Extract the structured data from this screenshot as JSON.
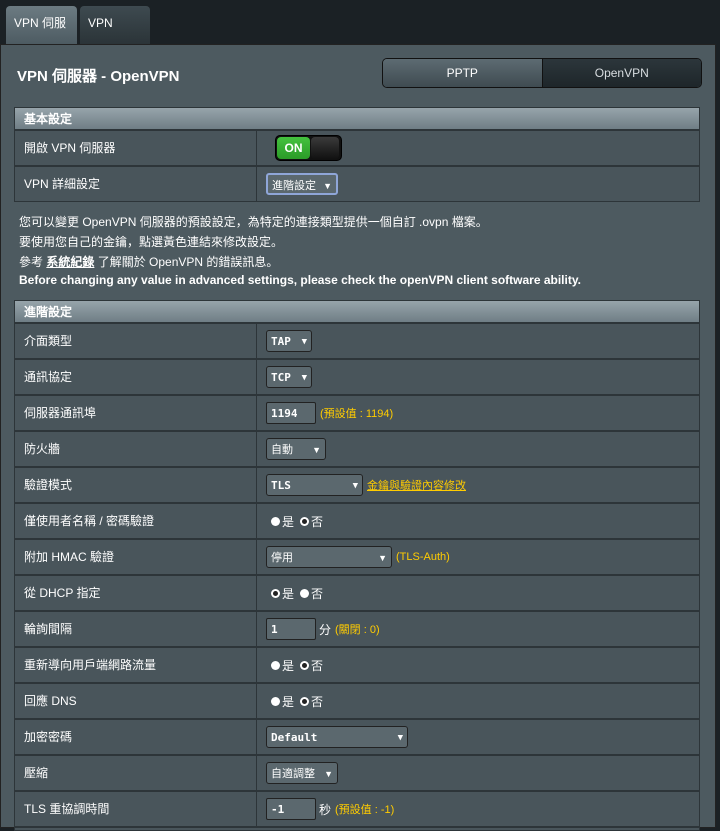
{
  "tabs": [
    {
      "label": "VPN 伺服器"
    },
    {
      "label": "VPN Client"
    }
  ],
  "page_title": "VPN 伺服器 - OpenVPN",
  "segments": [
    "PPTP",
    "OpenVPN"
  ],
  "basic": {
    "header": "基本設定",
    "enable_label": "開啟 VPN 伺服器",
    "toggle_text": "ON",
    "detail_label": "VPN 詳細設定",
    "detail_value": "進階設定"
  },
  "desc": {
    "line1": "您可以變更 OpenVPN 伺服器的預設設定，為特定的連接類型提供一個自訂 .ovpn 檔案。",
    "line2": "要使用您自己的金鑰，點選黃色連結來修改設定。",
    "line3_pre": "參考",
    "line3_link": "系統紀錄",
    "line3_post": "了解關於 OpenVPN 的錯誤訊息。",
    "line4": "Before changing any value in advanced settings, please check the openVPN client software ability."
  },
  "advanced": {
    "header": "進階設定",
    "rows": {
      "iface_label": "介面類型",
      "iface_value": "TAP",
      "proto_label": "通訊協定",
      "proto_value": "TCP",
      "port_label": "伺服器通訊埠",
      "port_value": "1194",
      "port_note": "(預設值 : 1194)",
      "fw_label": "防火牆",
      "fw_value": "自動",
      "auth_label": "驗證模式",
      "auth_value": "TLS",
      "auth_link": "金鑰與驗證內容修改",
      "userpass_label": "僅使用者名稱 / 密碼驗證",
      "hmac_label": "附加 HMAC 驗證",
      "hmac_value": "停用",
      "hmac_note": "(TLS-Auth)",
      "dhcp_label": "從 DHCP 指定",
      "poll_label": "輪詢間隔",
      "poll_value": "1",
      "poll_unit": "分",
      "poll_note": "(關閉 : 0)",
      "redirect_label": "重新導向用戶端網路流量",
      "dns_label": "回應 DNS",
      "cipher_label": "加密密碼",
      "cipher_value": "Default",
      "comp_label": "壓縮",
      "comp_value": "自適調整",
      "tls_label": "TLS 重協調時間",
      "tls_value": "-1",
      "tls_unit": "秒",
      "tls_note": "(預設值 : -1)"
    },
    "yes": "是",
    "no": "否"
  }
}
